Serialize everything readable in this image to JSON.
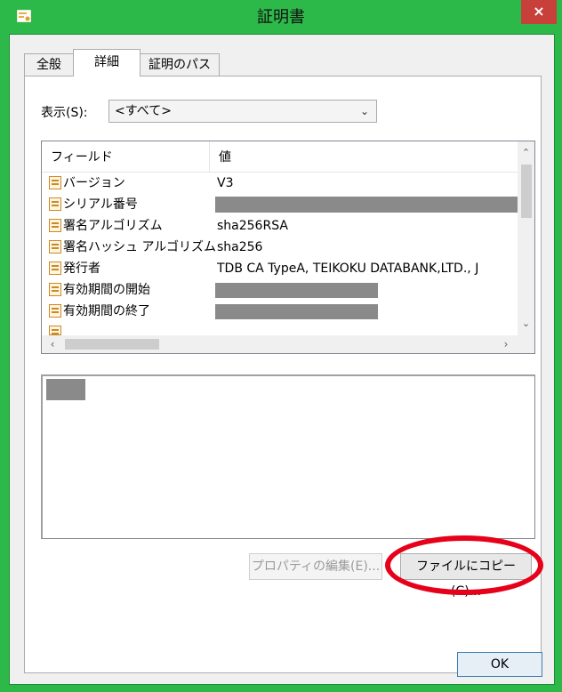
{
  "window": {
    "title": "証明書",
    "close_glyph": "×",
    "icon": "certificate-icon",
    "colors": {
      "frame": "#2db84a",
      "close": "#c7403a",
      "highlight": "#e6001a"
    }
  },
  "tabs": [
    {
      "label": "全般",
      "active": false
    },
    {
      "label": "詳細",
      "active": true
    },
    {
      "label": "証明のパス",
      "active": false
    }
  ],
  "show": {
    "label": "表示(S):",
    "value": "<すべて>"
  },
  "fields_list": {
    "columns": [
      "フィールド",
      "値"
    ],
    "rows": [
      {
        "field": "バージョン",
        "value": "V3"
      },
      {
        "field": "シリアル番号",
        "value": ""
      },
      {
        "field": "署名アルゴリズム",
        "value": "sha256RSA"
      },
      {
        "field": "署名ハッシュ アルゴリズム",
        "value": "sha256"
      },
      {
        "field": "発行者",
        "value": "TDB CA TypeA, TEIKOKU DATABANK,LTD., J"
      },
      {
        "field": "有効期間の開始",
        "value": ""
      },
      {
        "field": "有効期間の終了",
        "value": ""
      }
    ]
  },
  "buttons": {
    "edit_properties": "プロパティの編集(E)...",
    "copy_to_file": "ファイルにコピー(C)...",
    "ok": "OK"
  }
}
